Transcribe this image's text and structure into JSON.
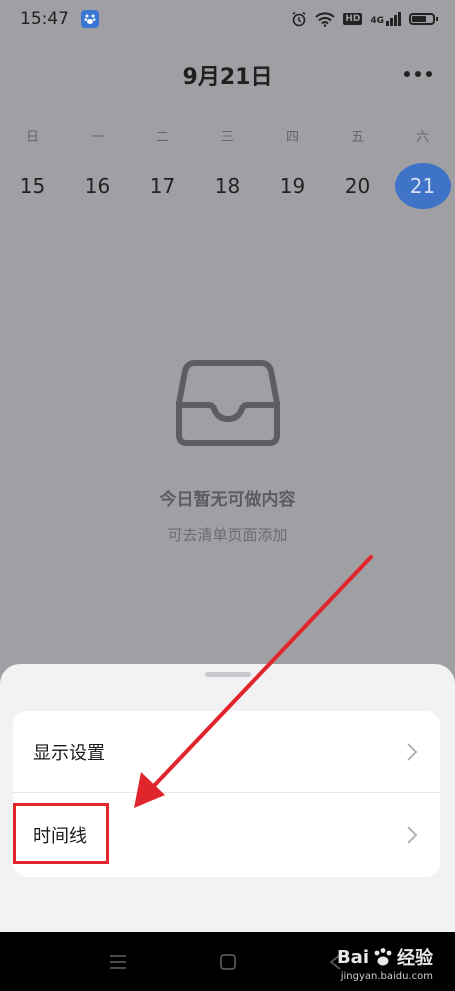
{
  "status_bar": {
    "time": "15:47",
    "network_label": "4G",
    "hd_label": "HD",
    "battery_level": 0.8
  },
  "header": {
    "title": "9月21日"
  },
  "week": {
    "labels": [
      "日",
      "一",
      "二",
      "三",
      "四",
      "五",
      "六"
    ],
    "dates": [
      "15",
      "16",
      "17",
      "18",
      "19",
      "20",
      "21"
    ],
    "selected_index": 6
  },
  "empty_state": {
    "title": "今日暂无可做内容",
    "subtitle": "可去清单页面添加"
  },
  "sheet": {
    "items": [
      {
        "label": "显示设置"
      },
      {
        "label": "时间线"
      }
    ]
  },
  "watermark": {
    "brand": "Bai",
    "brand_suffix": "经验",
    "url": "jingyan.baidu.com"
  },
  "colors": {
    "accent": "#3f73c7",
    "annotation": "#e0262c",
    "overlay": "#a0a0a4"
  },
  "icons": [
    "baidu-app-icon",
    "alarm-icon",
    "wifi-icon",
    "signal-icon",
    "battery-icon",
    "more-icon",
    "inbox-tray-icon",
    "chevron-right-icon",
    "menu-icon",
    "home-icon",
    "back-icon",
    "paw-icon"
  ]
}
